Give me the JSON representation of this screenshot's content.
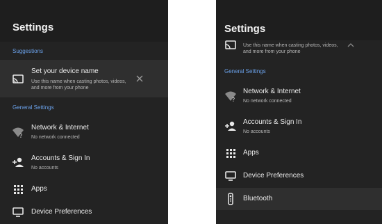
{
  "left": {
    "title": "Settings",
    "suggestions_header": "Suggestions",
    "suggestion": {
      "label": "Set your device name",
      "desc1": "Use this name when casting photos, videos,",
      "desc2": "and more from your phone",
      "icon": "cast-icon",
      "close_icon": "close-icon"
    },
    "general_header": "General Settings",
    "items": [
      {
        "label": "Network & Internet",
        "sub": "No network connected",
        "icon": "wifi-question-icon"
      },
      {
        "label": "Accounts & Sign In",
        "sub": "No accounts",
        "icon": "person-add-icon"
      },
      {
        "label": "Apps",
        "sub": "",
        "icon": "apps-grid-icon"
      },
      {
        "label": "Device Preferences",
        "sub": "",
        "icon": "tv-icon"
      }
    ]
  },
  "right": {
    "title": "Settings",
    "suggestion_partial": {
      "desc1": "Use this name when casting photos, videos,",
      "desc2": "and more from your phone",
      "icon": "cast-icon",
      "chevron_icon": "chevron-up-icon"
    },
    "general_header": "General Settings",
    "items": [
      {
        "label": "Network & Internet",
        "sub": "No network connected",
        "icon": "wifi-question-icon"
      },
      {
        "label": "Accounts & Sign In",
        "sub": "No accounts",
        "icon": "person-add-icon"
      },
      {
        "label": "Apps",
        "sub": "",
        "icon": "apps-grid-icon"
      },
      {
        "label": "Device Preferences",
        "sub": "",
        "icon": "tv-icon"
      },
      {
        "label": "Bluetooth",
        "sub": "",
        "icon": "remote-icon"
      }
    ]
  },
  "colors": {
    "panel_bg": "#232323",
    "header_bg": "#1e1e1e",
    "selected_bg": "#2f2f2f",
    "section_accent": "#6aa0e8",
    "text_primary": "#ededed",
    "text_secondary": "#b8b8b8"
  }
}
